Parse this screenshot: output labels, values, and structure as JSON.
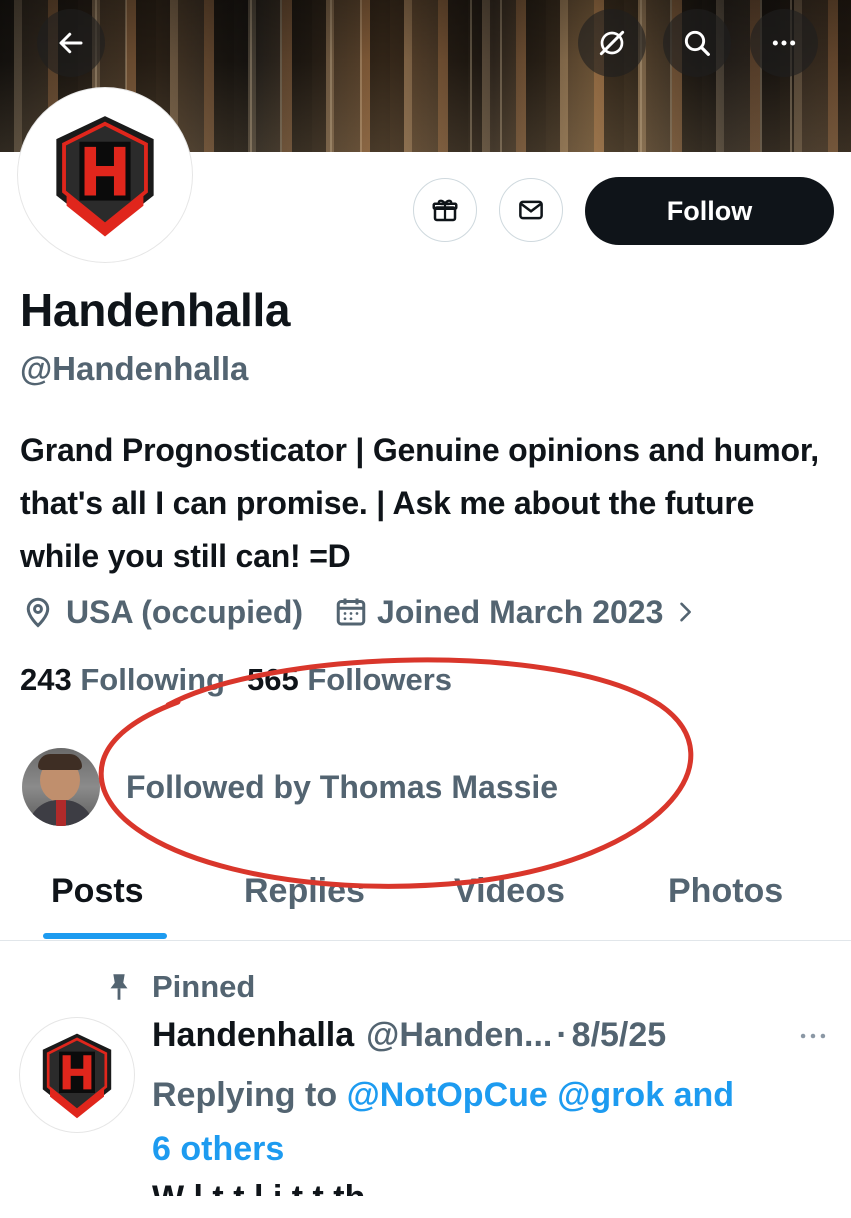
{
  "header": {
    "back_icon": "back-arrow-icon",
    "actions": [
      "grok-icon",
      "search-icon",
      "more-icon"
    ]
  },
  "profile": {
    "display_name": "Handenhalla",
    "handle": "@Handenhalla",
    "bio": "Grand Prognosticator | Genuine opinions and humor, that's all I can promise. | Ask me about the future while you still can! =D",
    "location": "USA (occupied)",
    "joined": "Joined March 2023",
    "following_count": "243",
    "following_label": "Following",
    "followers_count": "565",
    "followers_label": "Followers",
    "followed_by": "Followed by Thomas Massie",
    "follow_button": "Follow",
    "brand_red": "#e0261c"
  },
  "tabs": [
    {
      "label": "Posts",
      "active": true
    },
    {
      "label": "Replies",
      "active": false
    },
    {
      "label": "Videos",
      "active": false
    },
    {
      "label": "Photos",
      "active": false
    }
  ],
  "post": {
    "pinned_label": "Pinned",
    "author": "Handenhalla",
    "author_handle": "@Handen...",
    "separator": "·",
    "date": "8/5/25",
    "replying_prefix": "Replying to",
    "mention1": "@NotOpCue",
    "mention2": "@grok",
    "mention_joiner": "and",
    "others": "6 others",
    "cutoff_text": "W  l              t     t            l     i    t  t  th"
  },
  "annotation": {
    "color": "#d9362b"
  }
}
